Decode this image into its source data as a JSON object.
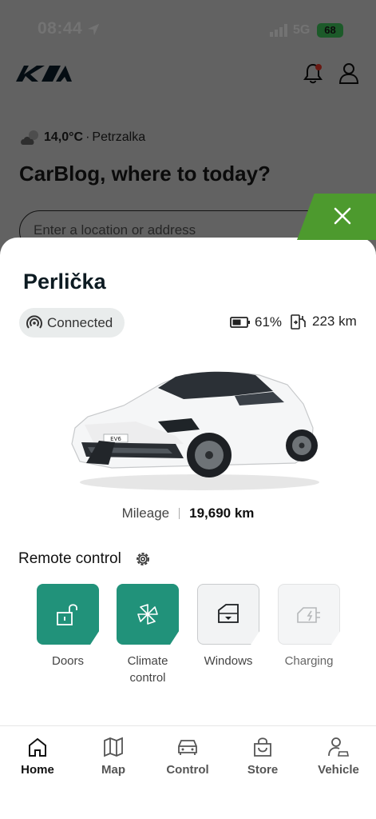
{
  "status_bar": {
    "time": "08:44",
    "network": "5G",
    "battery": "68"
  },
  "background": {
    "weather_temp": "14,0°C",
    "weather_separator": "·",
    "weather_location": "Petrzalka",
    "greeting": "CarBlog, where to today?",
    "search_placeholder": "Enter a location or address"
  },
  "vehicle": {
    "name": "Perlička",
    "connection_status": "Connected",
    "battery_level": "61%",
    "range": "223 km",
    "plate": "EV6",
    "mileage_label": "Mileage",
    "mileage_value": "19,690 km"
  },
  "remote_control": {
    "title": "Remote control",
    "controls": [
      {
        "label": "Doors",
        "state": "active",
        "icon": "unlock-icon"
      },
      {
        "label": "Climate control",
        "state": "active",
        "icon": "fan-icon"
      },
      {
        "label": "Windows",
        "state": "inactive",
        "icon": "window-icon"
      },
      {
        "label": "Charging",
        "state": "disabled",
        "icon": "charging-plug-icon"
      }
    ]
  },
  "nav": {
    "items": [
      {
        "label": "Home",
        "icon": "home-icon",
        "active": true
      },
      {
        "label": "Map",
        "icon": "map-icon",
        "active": false
      },
      {
        "label": "Control",
        "icon": "car-icon",
        "active": false
      },
      {
        "label": "Store",
        "icon": "shopping-bag-icon",
        "active": false
      },
      {
        "label": "Vehicle",
        "icon": "person-car-icon",
        "active": false
      }
    ]
  },
  "colors": {
    "accent_teal": "#21927a",
    "close_green": "#4d9a2e",
    "notification_red": "#e8392a",
    "battery_green": "#3ec85c"
  }
}
